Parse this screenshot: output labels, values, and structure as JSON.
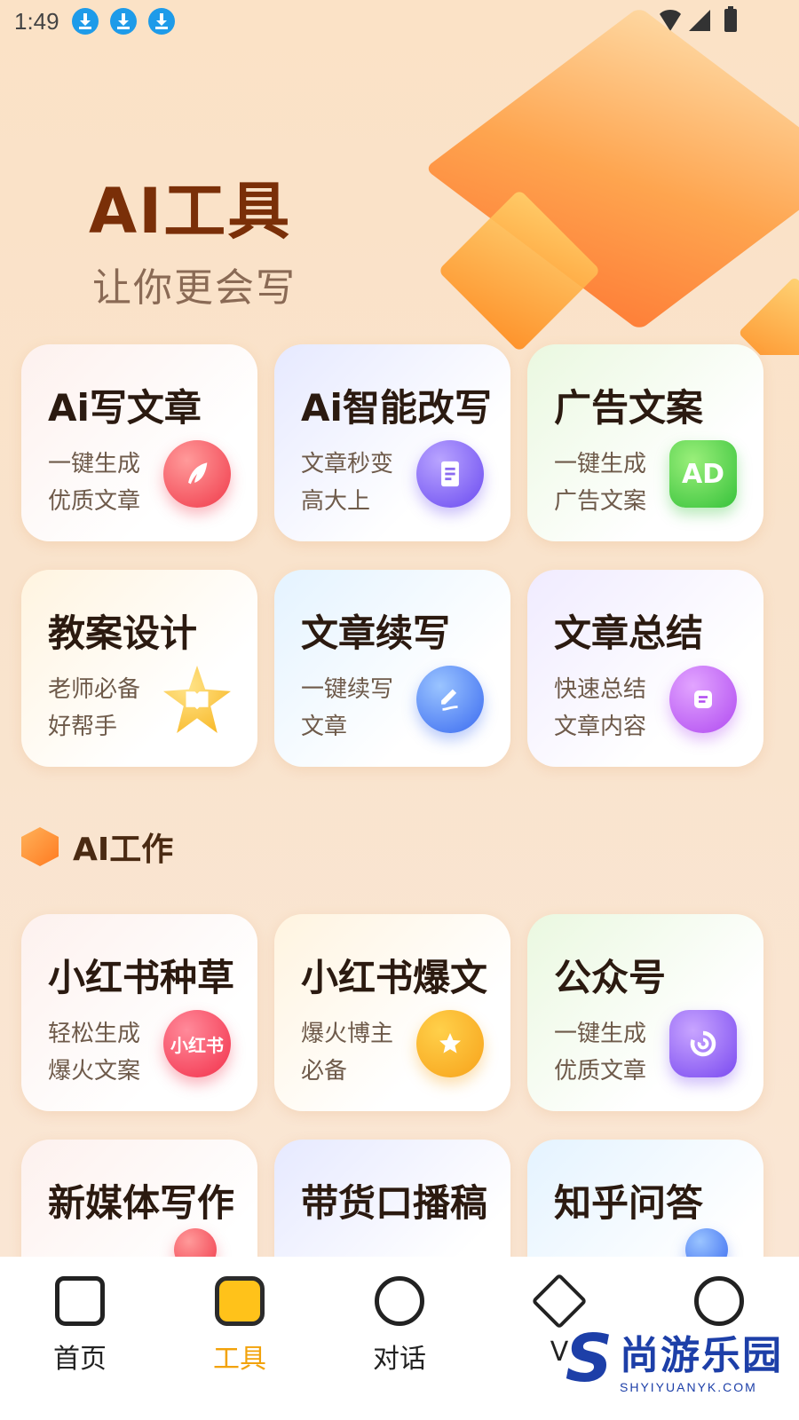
{
  "status_bar": {
    "time": "1:49"
  },
  "hero": {
    "title": "AI工具",
    "subtitle": "让你更会写"
  },
  "tools": [
    {
      "title": "Ai写文章",
      "desc1": "一键生成",
      "desc2": "优质文章",
      "icon": "feather-icon"
    },
    {
      "title": "Ai智能改写",
      "desc1": "文章秒变",
      "desc2": "高大上",
      "icon": "scroll-icon"
    },
    {
      "title": "广告文案",
      "desc1": "一键生成",
      "desc2": "广告文案",
      "icon": "ad-icon",
      "icon_text": "AD"
    },
    {
      "title": "教案设计",
      "desc1": "老师必备",
      "desc2": "好帮手",
      "icon": "book-star-icon"
    },
    {
      "title": "文章续写",
      "desc1": "一键续写",
      "desc2": "文章",
      "icon": "pen-bubble-icon"
    },
    {
      "title": "文章总结",
      "desc1": "快速总结",
      "desc2": "文章内容",
      "icon": "note-pin-icon"
    }
  ],
  "section": {
    "title": "AI工作"
  },
  "work": [
    {
      "title": "小红书种草",
      "desc1": "轻松生成",
      "desc2": "爆火文案",
      "icon": "xiaohongshu-heart-icon",
      "icon_text": "小红书"
    },
    {
      "title": "小红书爆文",
      "desc1": "爆火博主",
      "desc2": "必备",
      "icon": "star-coin-icon"
    },
    {
      "title": "公众号",
      "desc1": "一键生成",
      "desc2": "优质文章",
      "icon": "swirl-icon"
    },
    {
      "title": "新媒体写作"
    },
    {
      "title": "带货口播稿"
    },
    {
      "title": "知乎问答"
    }
  ],
  "nav": [
    {
      "label": "首页",
      "icon": "home-icon",
      "active": false
    },
    {
      "label": "工具",
      "icon": "toolbox-icon",
      "active": true
    },
    {
      "label": "对话",
      "icon": "chat-icon",
      "active": false
    },
    {
      "label": "V",
      "icon": "vip-diamond-icon",
      "active": false
    },
    {
      "label": "",
      "icon": "profile-icon",
      "active": false
    }
  ],
  "watermark": {
    "cn": "尚游乐园",
    "en": "SHYIYUANYK.COM",
    "mark": "S"
  },
  "colors": {
    "accent": "#f2a20a",
    "hero_title": "#7a2f08",
    "watermark": "#1d3fa8"
  }
}
